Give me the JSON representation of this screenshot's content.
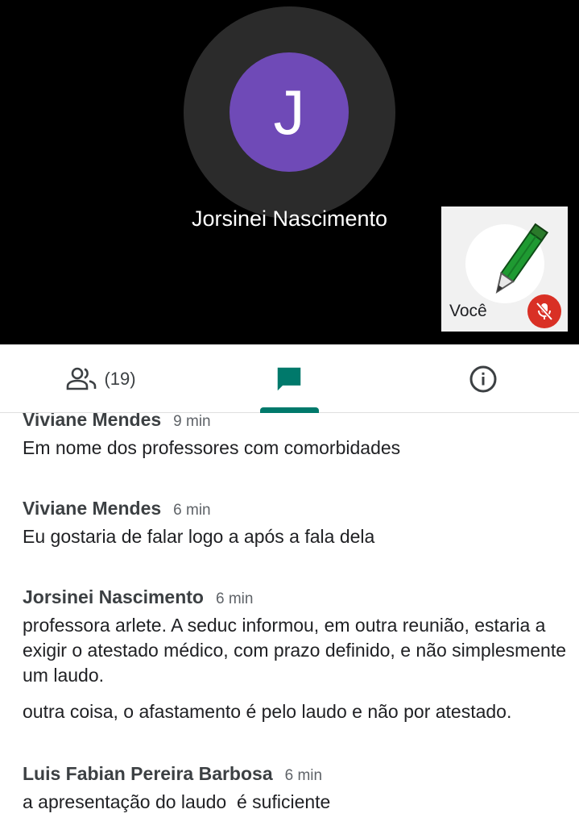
{
  "stage": {
    "avatar_initial": "J",
    "presenter_name": "Jorsinei Nascimento",
    "avatar_color": "#6f4ab7",
    "self_label": "Você",
    "self_mic_status": "muted"
  },
  "tabs": {
    "people_count": "(19)",
    "active_tab": "chat",
    "accent_color": "#00796b"
  },
  "messages": [
    {
      "sender": "Viviane Mendes",
      "time": "9 min",
      "texts": [
        "Em nome dos professores com comorbidades"
      ]
    },
    {
      "sender": "Viviane Mendes",
      "time": "6 min",
      "texts": [
        "Eu gostaria de falar logo a após a fala dela"
      ]
    },
    {
      "sender": "Jorsinei Nascimento",
      "time": "6 min",
      "texts": [
        "professora arlete. A seduc informou, em outra reunião, estaria a exigir o atestado médico, com prazo definido, e não simplesmente um laudo.",
        "outra coisa, o afastamento é pelo laudo e não por atestado."
      ]
    },
    {
      "sender": "Luis Fabian Pereira Barbosa",
      "time": "6 min",
      "texts": [
        "a apresentação do laudo  é suficiente"
      ]
    }
  ]
}
